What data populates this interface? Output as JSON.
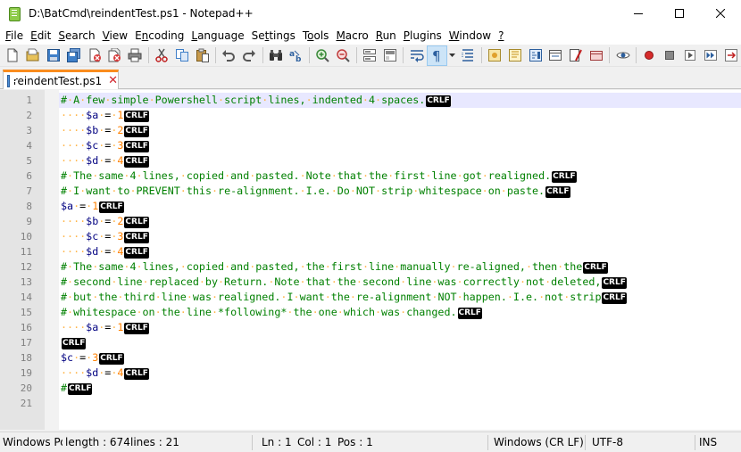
{
  "window": {
    "title": "D:\\BatCmd\\reindentTest.ps1 - Notepad++"
  },
  "menu": [
    {
      "label": "File",
      "key": "F",
      "rest": "ile"
    },
    {
      "label": "Edit",
      "key": "E",
      "rest": "dit"
    },
    {
      "label": "Search",
      "key": "S",
      "rest": "earch"
    },
    {
      "label": "View",
      "key": "V",
      "rest": "iew"
    },
    {
      "label": "Encoding",
      "key": "n",
      "pre": "E",
      "rest": "coding"
    },
    {
      "label": "Language",
      "key": "L",
      "rest": "anguage"
    },
    {
      "label": "Settings",
      "key": "t",
      "pre": "Se",
      "rest": "tings"
    },
    {
      "label": "Tools",
      "key": "o",
      "pre": "T",
      "rest": "ols"
    },
    {
      "label": "Macro",
      "key": "M",
      "rest": "acro"
    },
    {
      "label": "Run",
      "key": "R",
      "rest": "un"
    },
    {
      "label": "Plugins",
      "key": "P",
      "rest": "lugins"
    },
    {
      "label": "Window",
      "key": "W",
      "rest": "indow"
    },
    {
      "label": "?",
      "key": "?",
      "rest": ""
    }
  ],
  "tab": {
    "label": "reindentTest.ps1",
    "close": "✕"
  },
  "editor": {
    "eol_marker": "CRLF",
    "lines": [
      {
        "n": "1",
        "indent": "",
        "text": "# A few simple Powershell script lines, indented 4 spaces.",
        "kind": "comment",
        "current": true
      },
      {
        "n": "2",
        "indent": "····",
        "var": "$a",
        "num": "1",
        "kind": "assign"
      },
      {
        "n": "3",
        "indent": "····",
        "var": "$b",
        "num": "2",
        "kind": "assign"
      },
      {
        "n": "4",
        "indent": "····",
        "var": "$c",
        "num": "3",
        "kind": "assign"
      },
      {
        "n": "5",
        "indent": "····",
        "var": "$d",
        "num": "4",
        "kind": "assign"
      },
      {
        "n": "6",
        "indent": "",
        "text": "# The same 4 lines, copied and pasted. Note that the first line got realigned.",
        "kind": "comment"
      },
      {
        "n": "7",
        "indent": "",
        "text": "# I want to PREVENT this re-alignment. I.e. Do NOT strip whitespace on paste.",
        "kind": "comment"
      },
      {
        "n": "8",
        "indent": "",
        "var": "$a",
        "num": "1",
        "kind": "assign"
      },
      {
        "n": "9",
        "indent": "····",
        "var": "$b",
        "num": "2",
        "kind": "assign"
      },
      {
        "n": "10",
        "indent": "····",
        "var": "$c",
        "num": "3",
        "kind": "assign"
      },
      {
        "n": "11",
        "indent": "····",
        "var": "$d",
        "num": "4",
        "kind": "assign"
      },
      {
        "n": "12",
        "indent": "",
        "text": "# The same 4 lines, copied and pasted, the first line manually re-aligned, then the",
        "kind": "comment"
      },
      {
        "n": "13",
        "indent": "",
        "text": "# second line replaced by Return. Note that the second line was correctly not deleted,",
        "kind": "comment"
      },
      {
        "n": "14",
        "indent": "",
        "text": "# but the third line was realigned. I want the re-alignment NOT happen. I.e. not strip",
        "kind": "comment"
      },
      {
        "n": "15",
        "indent": "",
        "text": "# whitespace on the line *following* the one which was changed.",
        "kind": "comment"
      },
      {
        "n": "16",
        "indent": "····",
        "var": "$a",
        "num": "1",
        "kind": "assign"
      },
      {
        "n": "17",
        "indent": "",
        "kind": "empty"
      },
      {
        "n": "18",
        "indent": "",
        "var": "$c",
        "num": "3",
        "kind": "assign"
      },
      {
        "n": "19",
        "indent": "····",
        "var": "$d",
        "num": "4",
        "kind": "assign"
      },
      {
        "n": "20",
        "indent": "",
        "text": "#",
        "kind": "comment"
      },
      {
        "n": "21",
        "indent": "",
        "kind": "last"
      }
    ]
  },
  "status": {
    "lang": "Windows Po",
    "length": "length : 674",
    "lines": "lines : 21",
    "ln": "Ln : 1",
    "col": "Col : 1",
    "pos": "Pos : 1",
    "eol": "Windows (CR LF)",
    "encoding": "UTF-8",
    "mode": "INS"
  },
  "colors": {
    "comment": "#008000",
    "variable": "#000080",
    "number": "#ff8000",
    "whitespace_dot": "#ffb54a",
    "current_line": "#e8e8ff",
    "tab_accent": "#fa8c1e"
  }
}
